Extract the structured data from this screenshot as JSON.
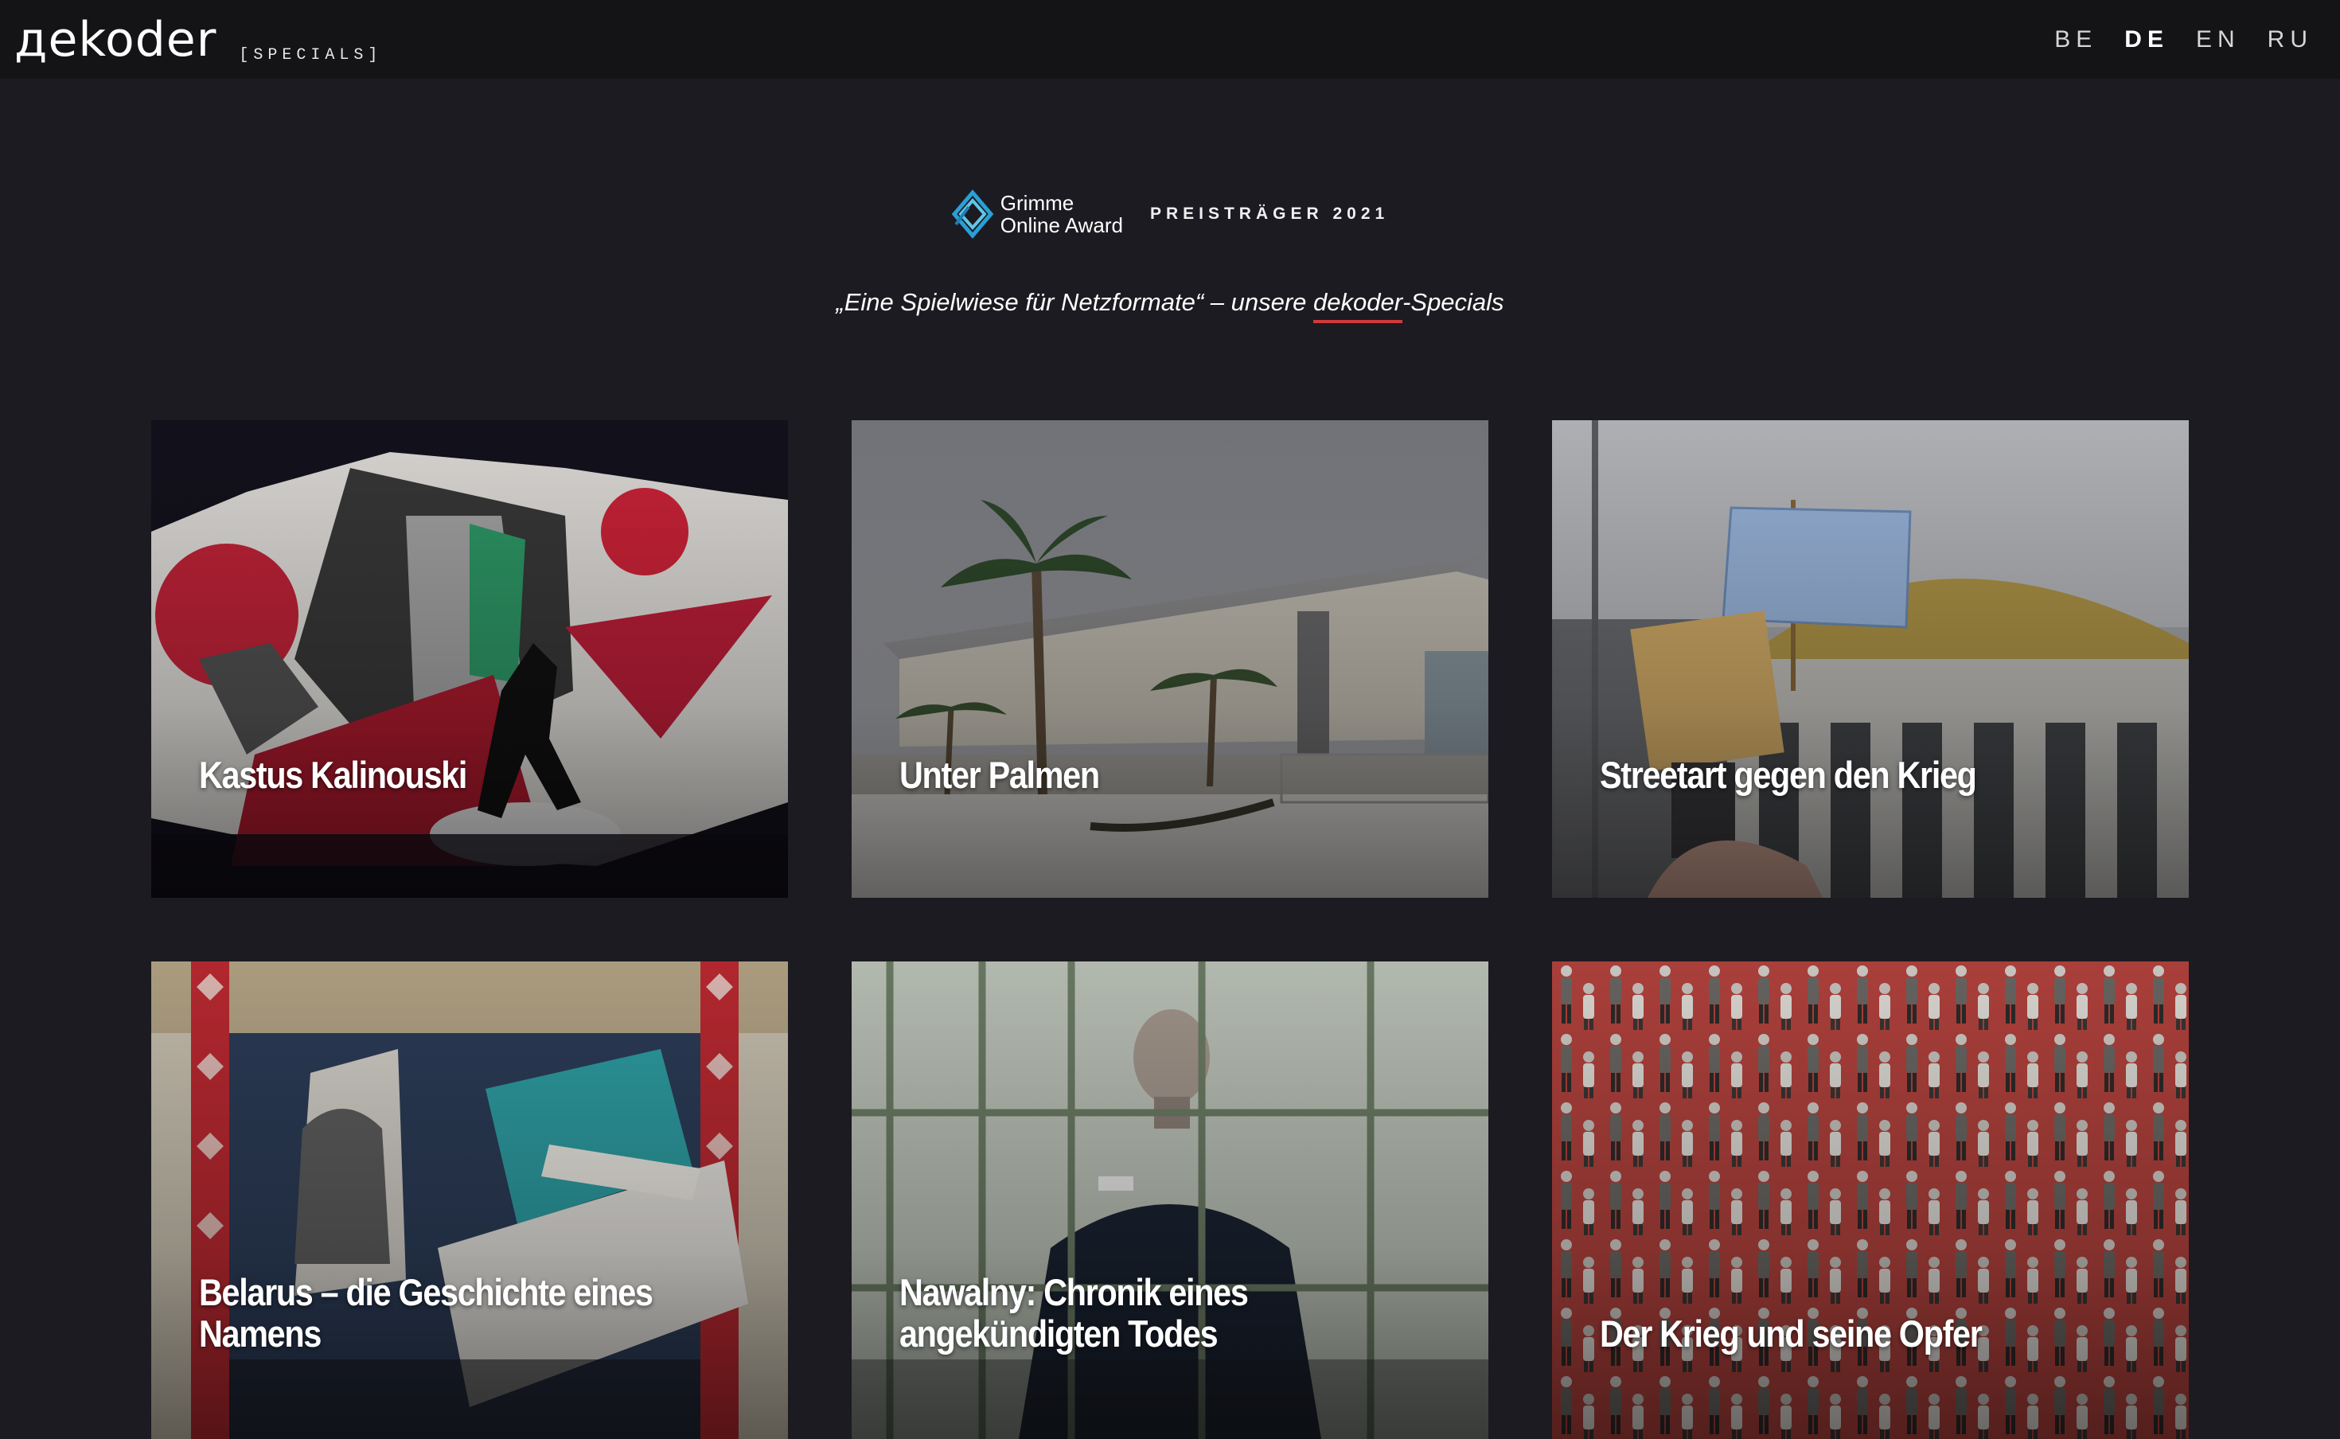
{
  "header": {
    "logo": "дekoder",
    "section": "[SPECIALS]",
    "languages": [
      {
        "code": "BE",
        "active": false
      },
      {
        "code": "DE",
        "active": true
      },
      {
        "code": "EN",
        "active": false
      },
      {
        "code": "RU",
        "active": false
      }
    ]
  },
  "award": {
    "name_line1": "Grimme",
    "name_line2": "Online Award",
    "label": "PREISTRÄGER 2021"
  },
  "tagline": {
    "before": "„Eine Spielwiese für Netzformate“ – unsere ",
    "highlight": "dekoder",
    "after": "-Specials"
  },
  "cards": [
    {
      "title": "Kastus Kalinouski",
      "image": "collage-portrait"
    },
    {
      "title": "Unter Palmen",
      "image": "building-with-palms"
    },
    {
      "title": "Streetart gegen den Krieg",
      "image": "protest-sign-puppet"
    },
    {
      "title": "Belarus – die Geschichte eines Namens",
      "image": "belarus-collage"
    },
    {
      "title": "Nawalny: Chronik eines angekündigten Todes",
      "image": "man-behind-bars"
    },
    {
      "title": "Der Krieg und seine Opfer",
      "image": "crowd-figures"
    }
  ],
  "colors": {
    "page_background": "#1c1b21",
    "header_background": "#141417",
    "accent": "#d23a3a",
    "award_blue": "#2a9fd6"
  }
}
